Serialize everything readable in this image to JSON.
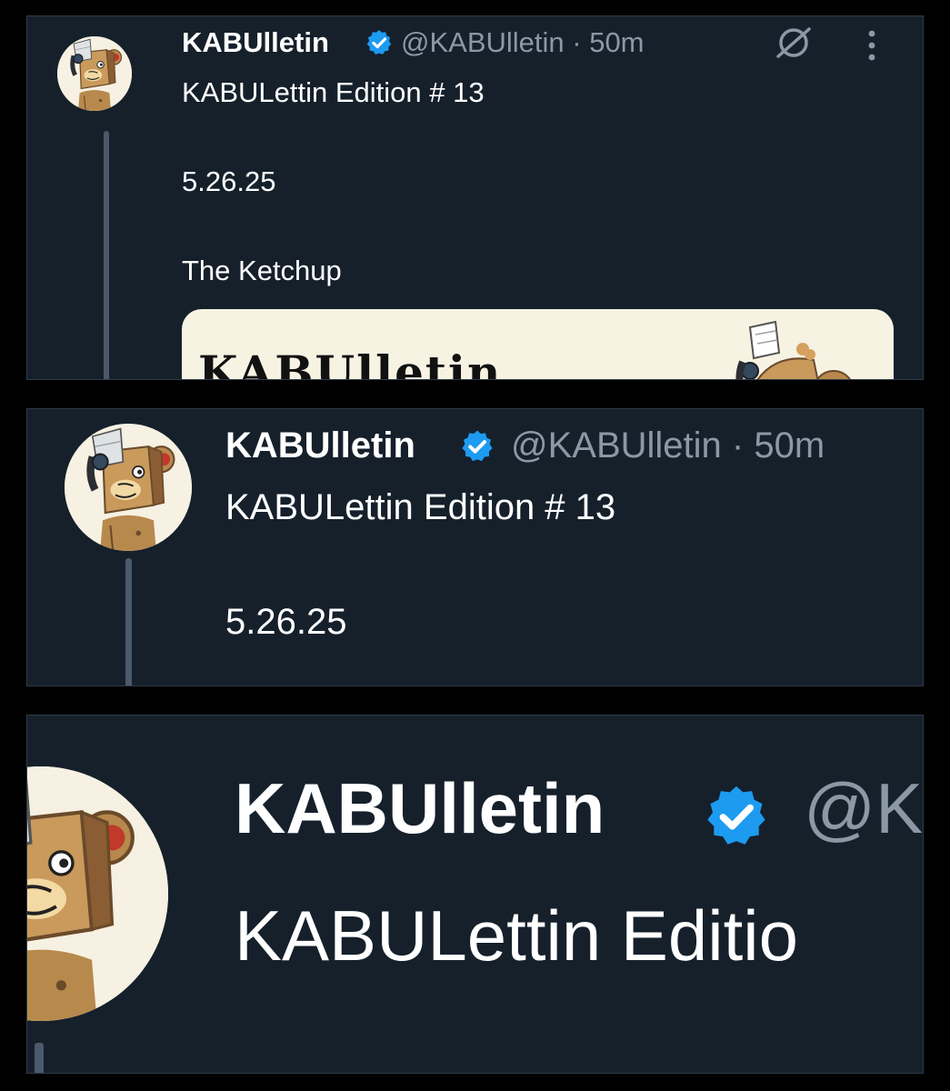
{
  "tweet": {
    "display_name": "KABUlletin",
    "handle": "@KABUlletin",
    "time_sep_time": " · 50m",
    "title_line": "KABULettin Edition # 13",
    "date_line": "5.26.25",
    "subtitle_line": "The Ketchup",
    "card_title": "KABUlletin",
    "handle_partial": "@K",
    "title_partial": "KABULettin Editio"
  },
  "icons": {
    "verified": "verified-badge-icon",
    "grok": "grok-icon",
    "more": "more-options-icon"
  },
  "colors": {
    "background": "#15202b",
    "outer": "#000000",
    "verified_blue": "#1d9bf0",
    "handle_gray": "#8b98a5",
    "card_bg": "#f7f3e3"
  }
}
